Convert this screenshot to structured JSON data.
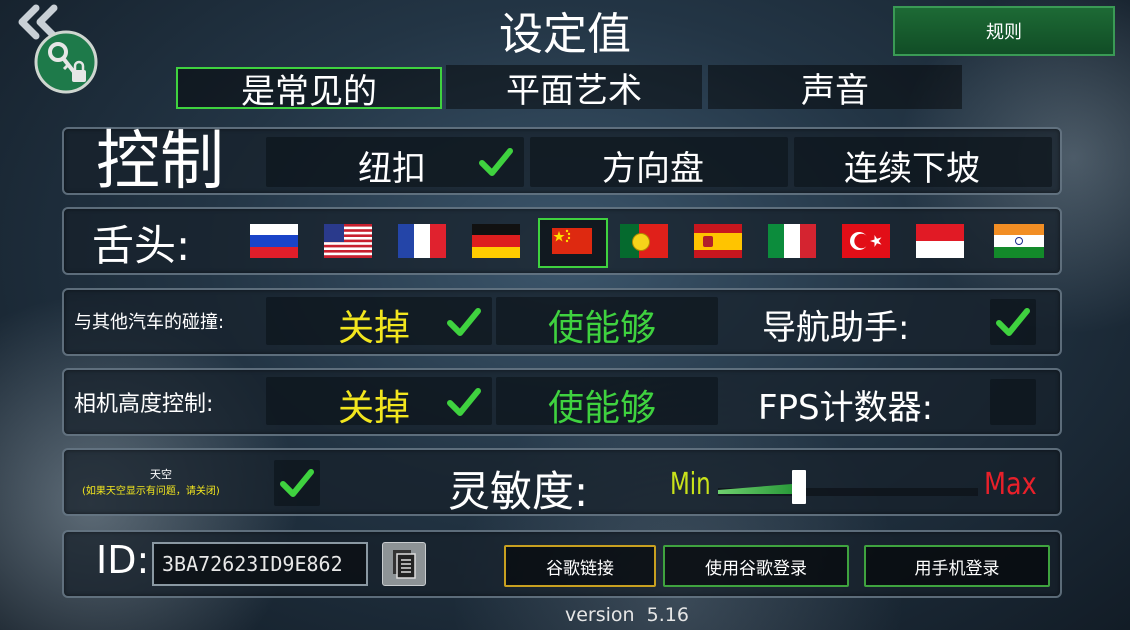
{
  "header": {
    "title": "设定值",
    "rules_label": "规则"
  },
  "tabs": [
    {
      "label": "是常见的",
      "active": true
    },
    {
      "label": "平面艺术",
      "active": false
    },
    {
      "label": "声音",
      "active": false
    }
  ],
  "controls": {
    "title": "控制",
    "options": [
      {
        "label": "纽扣",
        "checked": true
      },
      {
        "label": "方向盘",
        "checked": false
      },
      {
        "label": "连续下坡",
        "checked": false
      }
    ]
  },
  "language": {
    "label": "舌头:",
    "flags": [
      {
        "icon": "russia-flag",
        "selected": false
      },
      {
        "icon": "usa-flag",
        "selected": false
      },
      {
        "icon": "france-flag",
        "selected": false
      },
      {
        "icon": "germany-flag",
        "selected": false
      },
      {
        "icon": "china-flag",
        "selected": true
      },
      {
        "icon": "portugal-flag",
        "selected": false
      },
      {
        "icon": "spain-flag",
        "selected": false
      },
      {
        "icon": "italy-flag",
        "selected": false
      },
      {
        "icon": "turkey-flag",
        "selected": false
      },
      {
        "icon": "indonesia-flag",
        "selected": false
      },
      {
        "icon": "india-flag",
        "selected": false
      }
    ]
  },
  "collision": {
    "label": "与其他汽车的碰撞:",
    "off_label": "关掉",
    "on_label": "使能够",
    "selected": "off"
  },
  "navigation": {
    "label": "导航助手:",
    "checked": true
  },
  "camera_height": {
    "label": "相机高度控制:",
    "off_label": "关掉",
    "on_label": "使能够",
    "selected": "off"
  },
  "fps": {
    "label": "FPS计数器:",
    "checked": false
  },
  "sky": {
    "label": "天空",
    "hint": "(如果天空显示有问题，请关闭)",
    "checked": true
  },
  "sensitivity": {
    "label": "灵敏度:",
    "min_label": "Min",
    "max_label": "Max",
    "value": 0.3
  },
  "account": {
    "id_label": "ID:",
    "id_value": "3BA72623ID9E862",
    "google_link_label": "谷歌链接",
    "google_login_label": "使用谷歌登录",
    "phone_login_label": "用手机登录"
  },
  "version": "version  5.16",
  "colors": {
    "accent_green": "#3fd23f",
    "yellow": "#f2e61e",
    "max_red": "#e8202a",
    "min_yellow": "#c9e21a"
  }
}
